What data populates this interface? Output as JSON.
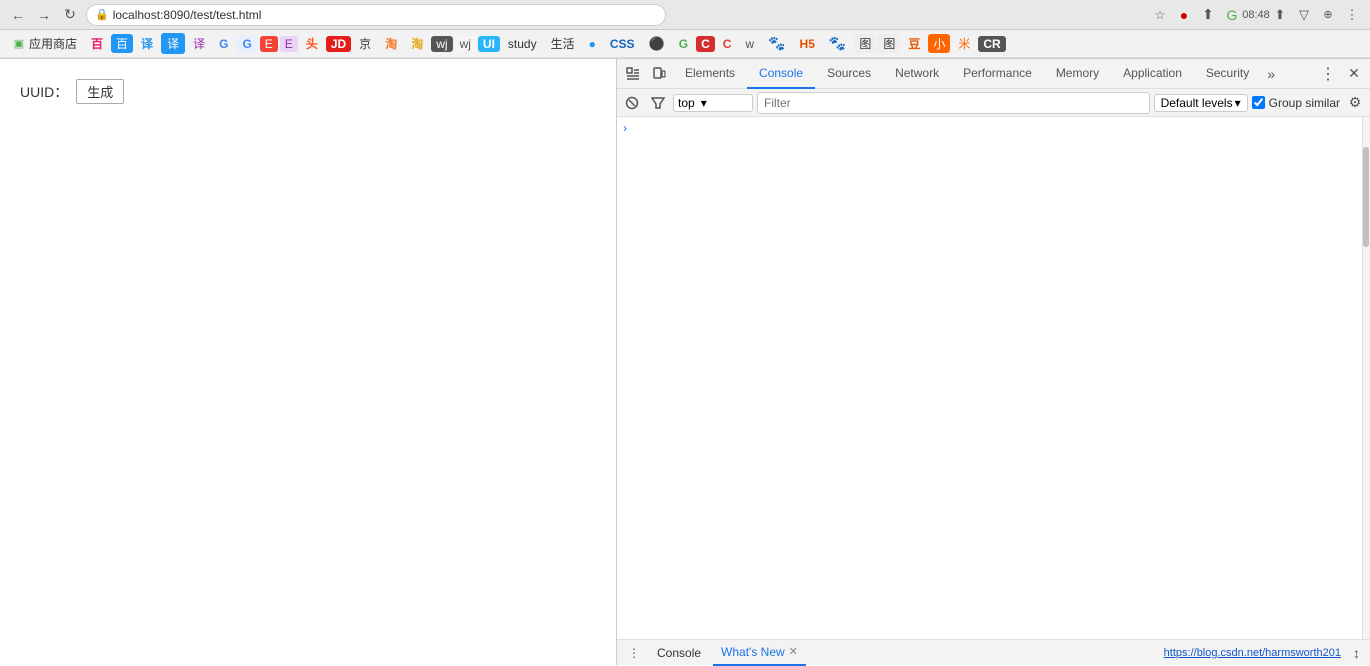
{
  "browser": {
    "url": "localhost:8090/test/test.html",
    "back_btn": "←",
    "forward_btn": "→",
    "reload_btn": "↻",
    "lock_icon": "🔒"
  },
  "bookmarks": [
    {
      "label": "应用商店",
      "icon": "🔵"
    },
    {
      "label": "百",
      "icon": ""
    },
    {
      "label": "百",
      "icon": ""
    },
    {
      "label": "译",
      "icon": ""
    },
    {
      "label": "译",
      "icon": ""
    },
    {
      "label": "译",
      "icon": ""
    },
    {
      "label": "G",
      "icon": ""
    },
    {
      "label": "G",
      "icon": ""
    },
    {
      "label": "E",
      "icon": ""
    },
    {
      "label": "E",
      "icon": ""
    },
    {
      "label": "头",
      "icon": ""
    },
    {
      "label": "JD",
      "icon": ""
    },
    {
      "label": "京",
      "icon": ""
    },
    {
      "label": "淘",
      "icon": ""
    },
    {
      "label": "淘",
      "icon": ""
    },
    {
      "label": "wj",
      "icon": ""
    },
    {
      "label": "wj",
      "icon": ""
    },
    {
      "label": "UI",
      "icon": ""
    },
    {
      "label": "study",
      "icon": ""
    },
    {
      "label": "生活",
      "icon": ""
    },
    {
      "label": "CSS",
      "icon": ""
    },
    {
      "label": "G",
      "icon": ""
    },
    {
      "label": "G",
      "icon": ""
    },
    {
      "label": "C",
      "icon": ""
    },
    {
      "label": "C",
      "icon": ""
    },
    {
      "label": "w",
      "icon": ""
    },
    {
      "label": "H5",
      "icon": ""
    },
    {
      "label": "图",
      "icon": ""
    },
    {
      "label": "图",
      "icon": ""
    },
    {
      "label": "豆",
      "icon": ""
    },
    {
      "label": "小",
      "icon": ""
    },
    {
      "label": "米",
      "icon": ""
    },
    {
      "label": "CR",
      "icon": ""
    }
  ],
  "page": {
    "uuid_label": "UUID：",
    "generate_btn": "生成"
  },
  "devtools": {
    "tabs": [
      {
        "label": "Elements",
        "active": false
      },
      {
        "label": "Console",
        "active": true
      },
      {
        "label": "Sources",
        "active": false
      },
      {
        "label": "Network",
        "active": false
      },
      {
        "label": "Performance",
        "active": false
      },
      {
        "label": "Memory",
        "active": false
      },
      {
        "label": "Application",
        "active": false
      },
      {
        "label": "Security",
        "active": false
      }
    ],
    "more_tabs": "»",
    "console_toolbar": {
      "context": "top",
      "filter_placeholder": "Filter",
      "default_levels": "Default levels",
      "group_similar": "Group similar"
    },
    "bottom_drawer": {
      "console_tab": "Console",
      "whats_new_tab": "What's New"
    },
    "status_url": "https://blog.csdn.net/harmsworth201"
  },
  "time": "08:48",
  "cursor_text": "↕"
}
